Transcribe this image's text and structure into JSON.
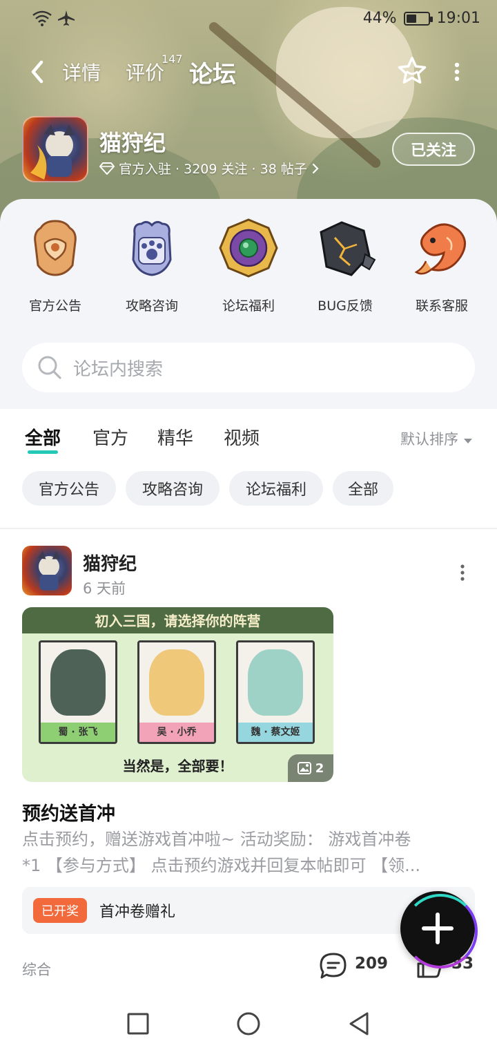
{
  "status": {
    "battery": "44%",
    "time": "19:01"
  },
  "nav": {
    "tabs": [
      {
        "label": "详情"
      },
      {
        "label": "评价"
      },
      {
        "label": "论坛"
      }
    ],
    "review_count": "147"
  },
  "game": {
    "name": "猫狩纪",
    "meta": "官方入驻 · 3209 关注 · 38 帖子",
    "follow_label": "已关注"
  },
  "categories": [
    {
      "label": "官方公告",
      "icon": "badge-icon"
    },
    {
      "label": "攻略咨询",
      "icon": "paw-shield-icon"
    },
    {
      "label": "论坛福利",
      "icon": "gem-medallion-icon"
    },
    {
      "label": "BUG反馈",
      "icon": "cracked-stone-icon"
    },
    {
      "label": "联系客服",
      "icon": "koi-fish-icon"
    }
  ],
  "search": {
    "placeholder": "论坛内搜索"
  },
  "feed": {
    "tabs": [
      "全部",
      "官方",
      "精华",
      "视频"
    ],
    "sort": "默认排序",
    "chips": [
      "官方公告",
      "攻略咨询",
      "论坛福利",
      "全部"
    ]
  },
  "post": {
    "author": "猫狩纪",
    "time": "6 天前",
    "image": {
      "header": "初入三国，请选择你的阵营",
      "cards": [
        "蜀 · 张飞",
        "吴 · 小乔",
        "魏 · 蔡文姬"
      ],
      "footer": "当然是，全部要！",
      "count": "2"
    },
    "title": "预约送首冲",
    "body_line1": "点击预约，赠送游戏首冲啦~ 活动奖励： 游戏首冲卷",
    "body_line2": "*1 【参与方式】 点击预约游戏并回复本帖即可 【领...",
    "lottery_badge": "已开奖",
    "lottery_text": "首冲卷赠礼",
    "tag": "综合",
    "comments": "209",
    "likes": "33"
  },
  "colors": {
    "accent": "#23c8b7",
    "lottery": "#f26a3c"
  }
}
